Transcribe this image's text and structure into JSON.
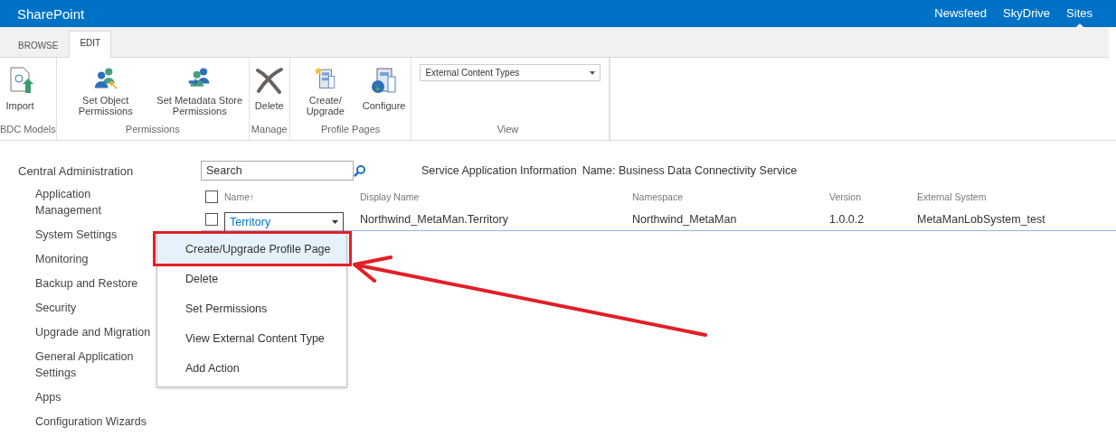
{
  "top_bar": {
    "brand": "SharePoint",
    "links": [
      {
        "label": "Newsfeed",
        "selected": false
      },
      {
        "label": "SkyDrive",
        "selected": false
      },
      {
        "label": "Sites",
        "selected": true
      }
    ]
  },
  "tabs": [
    {
      "label": "BROWSE",
      "selected": false
    },
    {
      "label": "EDIT",
      "selected": true
    }
  ],
  "ribbon": [
    {
      "label": "BDC Models",
      "buttons": [
        {
          "kind": "import",
          "label": "Import"
        }
      ]
    },
    {
      "label": "Permissions",
      "buttons": [
        {
          "kind": "object-permissions",
          "label": "Set Object Permissions"
        },
        {
          "kind": "store-permissions",
          "label": "Set Metadata Store Permissions"
        }
      ]
    },
    {
      "label": "Manage",
      "buttons": [
        {
          "kind": "delete",
          "label": "Delete"
        }
      ]
    },
    {
      "label": "Profile Pages",
      "buttons": [
        {
          "kind": "create",
          "label": "Create/ Upgrade"
        },
        {
          "kind": "configure",
          "label": "Configure"
        }
      ]
    },
    {
      "label": "View",
      "dropdown": {
        "value": "External Content Types"
      }
    }
  ],
  "sidebar": {
    "title": "Central Administration",
    "children": [
      {
        "label": "Application Management"
      },
      {
        "label": "System Settings"
      },
      {
        "label": "Monitoring"
      },
      {
        "label": "Backup and Restore"
      },
      {
        "label": "Security"
      },
      {
        "label": "Upgrade and Migration"
      },
      {
        "label": "General Application Settings"
      },
      {
        "label": "Apps"
      },
      {
        "label": "Configuration Wizards"
      }
    ]
  },
  "search": {
    "placeholder": "Search"
  },
  "info": {
    "title": "Service Application Information",
    "name": "Name: Business Data Connectivity Service"
  },
  "table": {
    "select_all": {
      "checked": false
    },
    "columns": [
      {
        "label": "Name↑"
      },
      {
        "label": "Display Name"
      },
      {
        "label": "Namespace"
      },
      {
        "label": "Version"
      },
      {
        "label": "External System"
      }
    ],
    "rows": [
      {
        "checked": false,
        "cells": [
          "Territory",
          "Northwind_MetaMan.Territory",
          "Northwind_MetaMan",
          "1.0.0.2",
          "MetaManLobSystem_test"
        ]
      }
    ]
  },
  "context_menu": [
    {
      "label": "Create/Upgrade Profile Page",
      "selected": true
    },
    {
      "label": "Delete",
      "selected": false
    },
    {
      "label": "Set Permissions",
      "selected": false
    },
    {
      "label": "View External Content Type",
      "selected": false
    },
    {
      "label": "Add Action",
      "selected": false
    }
  ]
}
